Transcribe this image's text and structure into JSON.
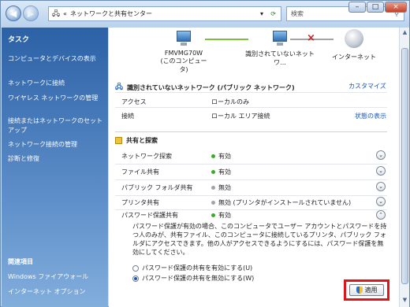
{
  "window": {
    "address": "ネットワークと共有センター",
    "search_placeholder": "検索",
    "controls": {
      "minimize": "–",
      "maximize": "□",
      "close": "×"
    }
  },
  "sidebar": {
    "title": "タスク",
    "items": [
      {
        "label": "コンピュータとデバイスの表示"
      },
      {
        "label": "ネットワークに接続"
      },
      {
        "label": "ワイヤレス ネットワークの管理"
      },
      {
        "label": "接続またはネットワークのセットアップ"
      },
      {
        "label": "ネットワーク接続の管理"
      },
      {
        "label": "診断と修復"
      }
    ],
    "related_title": "関連項目",
    "related_items": [
      {
        "label": "Windows ファイアウォール"
      },
      {
        "label": "インターネット オプション"
      }
    ]
  },
  "network_map": {
    "computer_name": "FMVMG70W",
    "computer_sub": "(このコンピュータ)",
    "network_name": "識別されていないネットワ...",
    "internet": "インターネット"
  },
  "network_section": {
    "title": "識別されていないネットワーク (パブリック ネットワーク)",
    "customize": "カスタマイズ",
    "rows": [
      {
        "label": "アクセス",
        "value": "ローカルのみ"
      },
      {
        "label": "接続",
        "value": "ローカル エリア接続",
        "link": "状態の表示"
      }
    ]
  },
  "sharing": {
    "title": "共有と探索",
    "rows": [
      {
        "label": "ネットワーク探索",
        "value": "有効",
        "status": "on"
      },
      {
        "label": "ファイル共有",
        "value": "有効",
        "status": "on"
      },
      {
        "label": "パブリック フォルダ共有",
        "value": "無効",
        "status": "off"
      },
      {
        "label": "プリンタ共有",
        "value": "無効 (プリンタがインストールされていません)",
        "status": "off"
      },
      {
        "label": "パスワード保護共有",
        "value": "有効",
        "status": "on"
      }
    ],
    "description": "パスワード保護が有効の場合、このコンピュータでユーザー アカウントとパスワードを持つ人のみが、共有ファイル、このコンピュータに接続しているプリンタ、パブリック フォルダにアクセスできます。他の人がアクセスできるようにするには、パスワード保護を無効にしてください。",
    "options": [
      {
        "label": "パスワード保護の共有を有効にする(U)",
        "checked": false
      },
      {
        "label": "パスワード保護の共有を無効にする(W)",
        "checked": true
      }
    ],
    "apply_label": "適用"
  }
}
